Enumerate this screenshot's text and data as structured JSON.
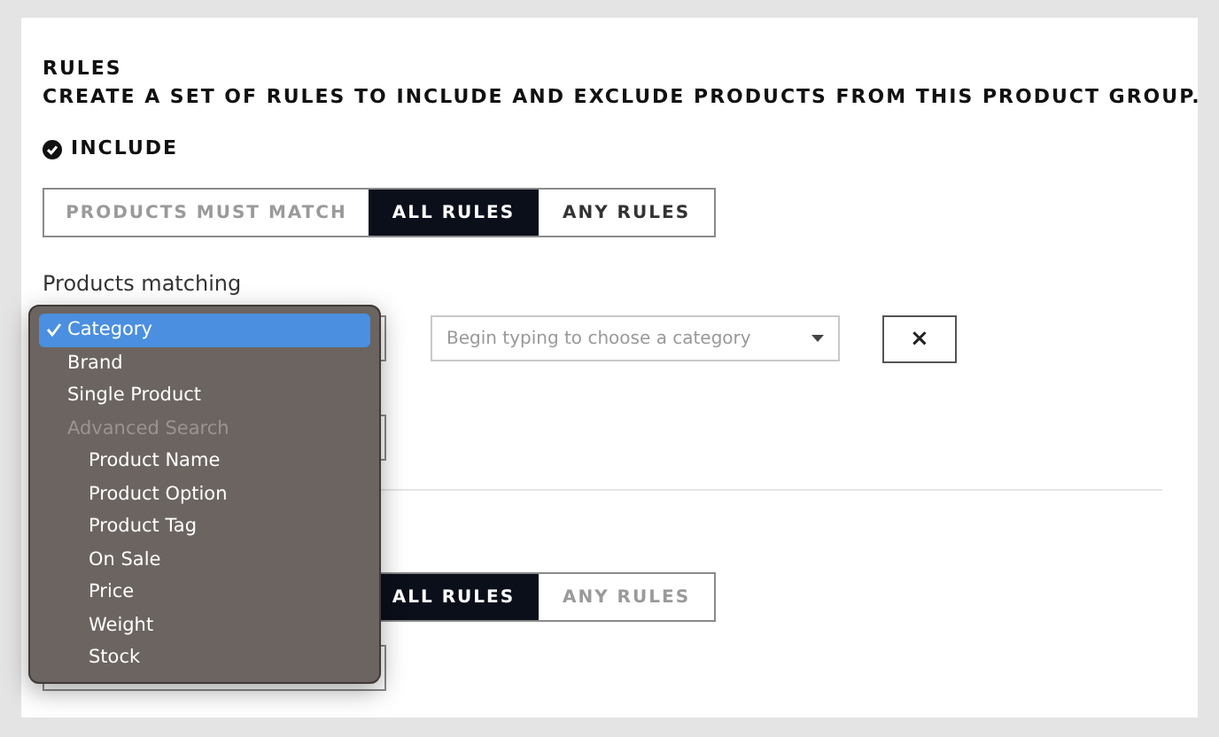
{
  "title": "RULES",
  "subtitle": "CREATE A SET OF RULES TO INCLUDE AND EXCLUDE PRODUCTS FROM THIS PRODUCT GROUP.",
  "include": {
    "label": "INCLUDE",
    "checked": true
  },
  "groups": [
    {
      "match_label": "PRODUCTS MUST MATCH",
      "options": [
        {
          "label": "ALL RULES",
          "selected": true,
          "disabled": false
        },
        {
          "label": "ANY RULES",
          "selected": false,
          "disabled": false
        }
      ]
    },
    {
      "options": [
        {
          "label": "ALL RULES",
          "selected": true,
          "disabled": false
        },
        {
          "label": "ANY RULES",
          "selected": false,
          "disabled": true
        }
      ]
    }
  ],
  "matching_label": "Products matching",
  "rule_row": {
    "value_field": {
      "placeholder": "Begin typing to choose a category"
    },
    "remove_button": "×"
  },
  "menu": {
    "items": [
      {
        "label": "Category",
        "selected": true,
        "disabled": false
      },
      {
        "label": "Brand",
        "selected": false,
        "disabled": false
      },
      {
        "label": "Single Product",
        "selected": false,
        "disabled": false
      },
      {
        "label": "Advanced Search",
        "selected": false,
        "disabled": true,
        "children": [
          {
            "label": "Product Name",
            "selected": false,
            "disabled": false
          },
          {
            "label": "Product Option",
            "selected": false,
            "disabled": false
          },
          {
            "label": "Product Tag",
            "selected": false,
            "disabled": false
          },
          {
            "label": "On Sale",
            "selected": false,
            "disabled": false
          },
          {
            "label": "Price",
            "selected": false,
            "disabled": false
          },
          {
            "label": "Weight",
            "selected": false,
            "disabled": false
          },
          {
            "label": "Stock",
            "selected": false,
            "disabled": false
          }
        ]
      }
    ]
  }
}
